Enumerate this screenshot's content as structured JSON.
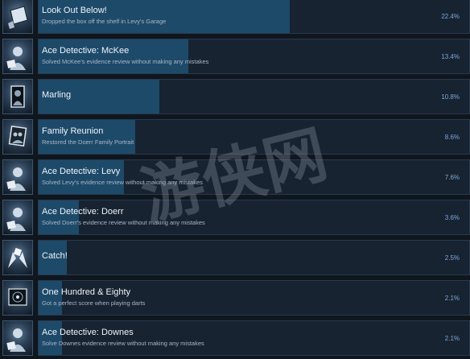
{
  "achievements": [
    {
      "title": "Look Out Below!",
      "description": "Dropped the box off the shelf in Levy's Garage",
      "percent": "22.4%",
      "fraction": 0.224,
      "icon": "box-icon"
    },
    {
      "title": "Ace Detective: McKee",
      "description": "Solved McKee's evidence review without making any mistakes",
      "percent": "13.4%",
      "fraction": 0.134,
      "icon": "detective-portrait-icon"
    },
    {
      "title": "Marling",
      "description": "",
      "percent": "10.8%",
      "fraction": 0.108,
      "icon": "portrait-frame-icon"
    },
    {
      "title": "Family Reunion",
      "description": "Restored the Doerr Family Portrait",
      "percent": "8.6%",
      "fraction": 0.086,
      "icon": "family-portrait-icon"
    },
    {
      "title": "Ace Detective: Levy",
      "description": "Solved Levy's evidence review without making any mistakes",
      "percent": "7.6%",
      "fraction": 0.076,
      "icon": "detective-portrait-icon"
    },
    {
      "title": "Ace Detective: Doerr",
      "description": "Solved Doerr's evidence review without making any mistakes",
      "percent": "3.6%",
      "fraction": 0.036,
      "icon": "detective-portrait-icon"
    },
    {
      "title": "Catch!",
      "description": "",
      "percent": "2.5%",
      "fraction": 0.025,
      "icon": "hands-catch-icon"
    },
    {
      "title": "One Hundred & Eighty",
      "description": "Got a perfect score when playing darts",
      "percent": "2.1%",
      "fraction": 0.021,
      "icon": "dartboard-icon"
    },
    {
      "title": "Ace Detective: Downes",
      "description": "Solve Downes evidence review without making any mistakes",
      "percent": "2.1%",
      "fraction": 0.021,
      "icon": "detective-portrait-icon"
    }
  ],
  "watermark": {
    "text": "游侠网"
  },
  "colors": {
    "background": "#10161e",
    "card": "#172331",
    "progress_fill": "#1e4a6a",
    "percent_text": "#7fa8d8",
    "title_text": "#eef3f8",
    "description_text": "#a9b6c4"
  }
}
